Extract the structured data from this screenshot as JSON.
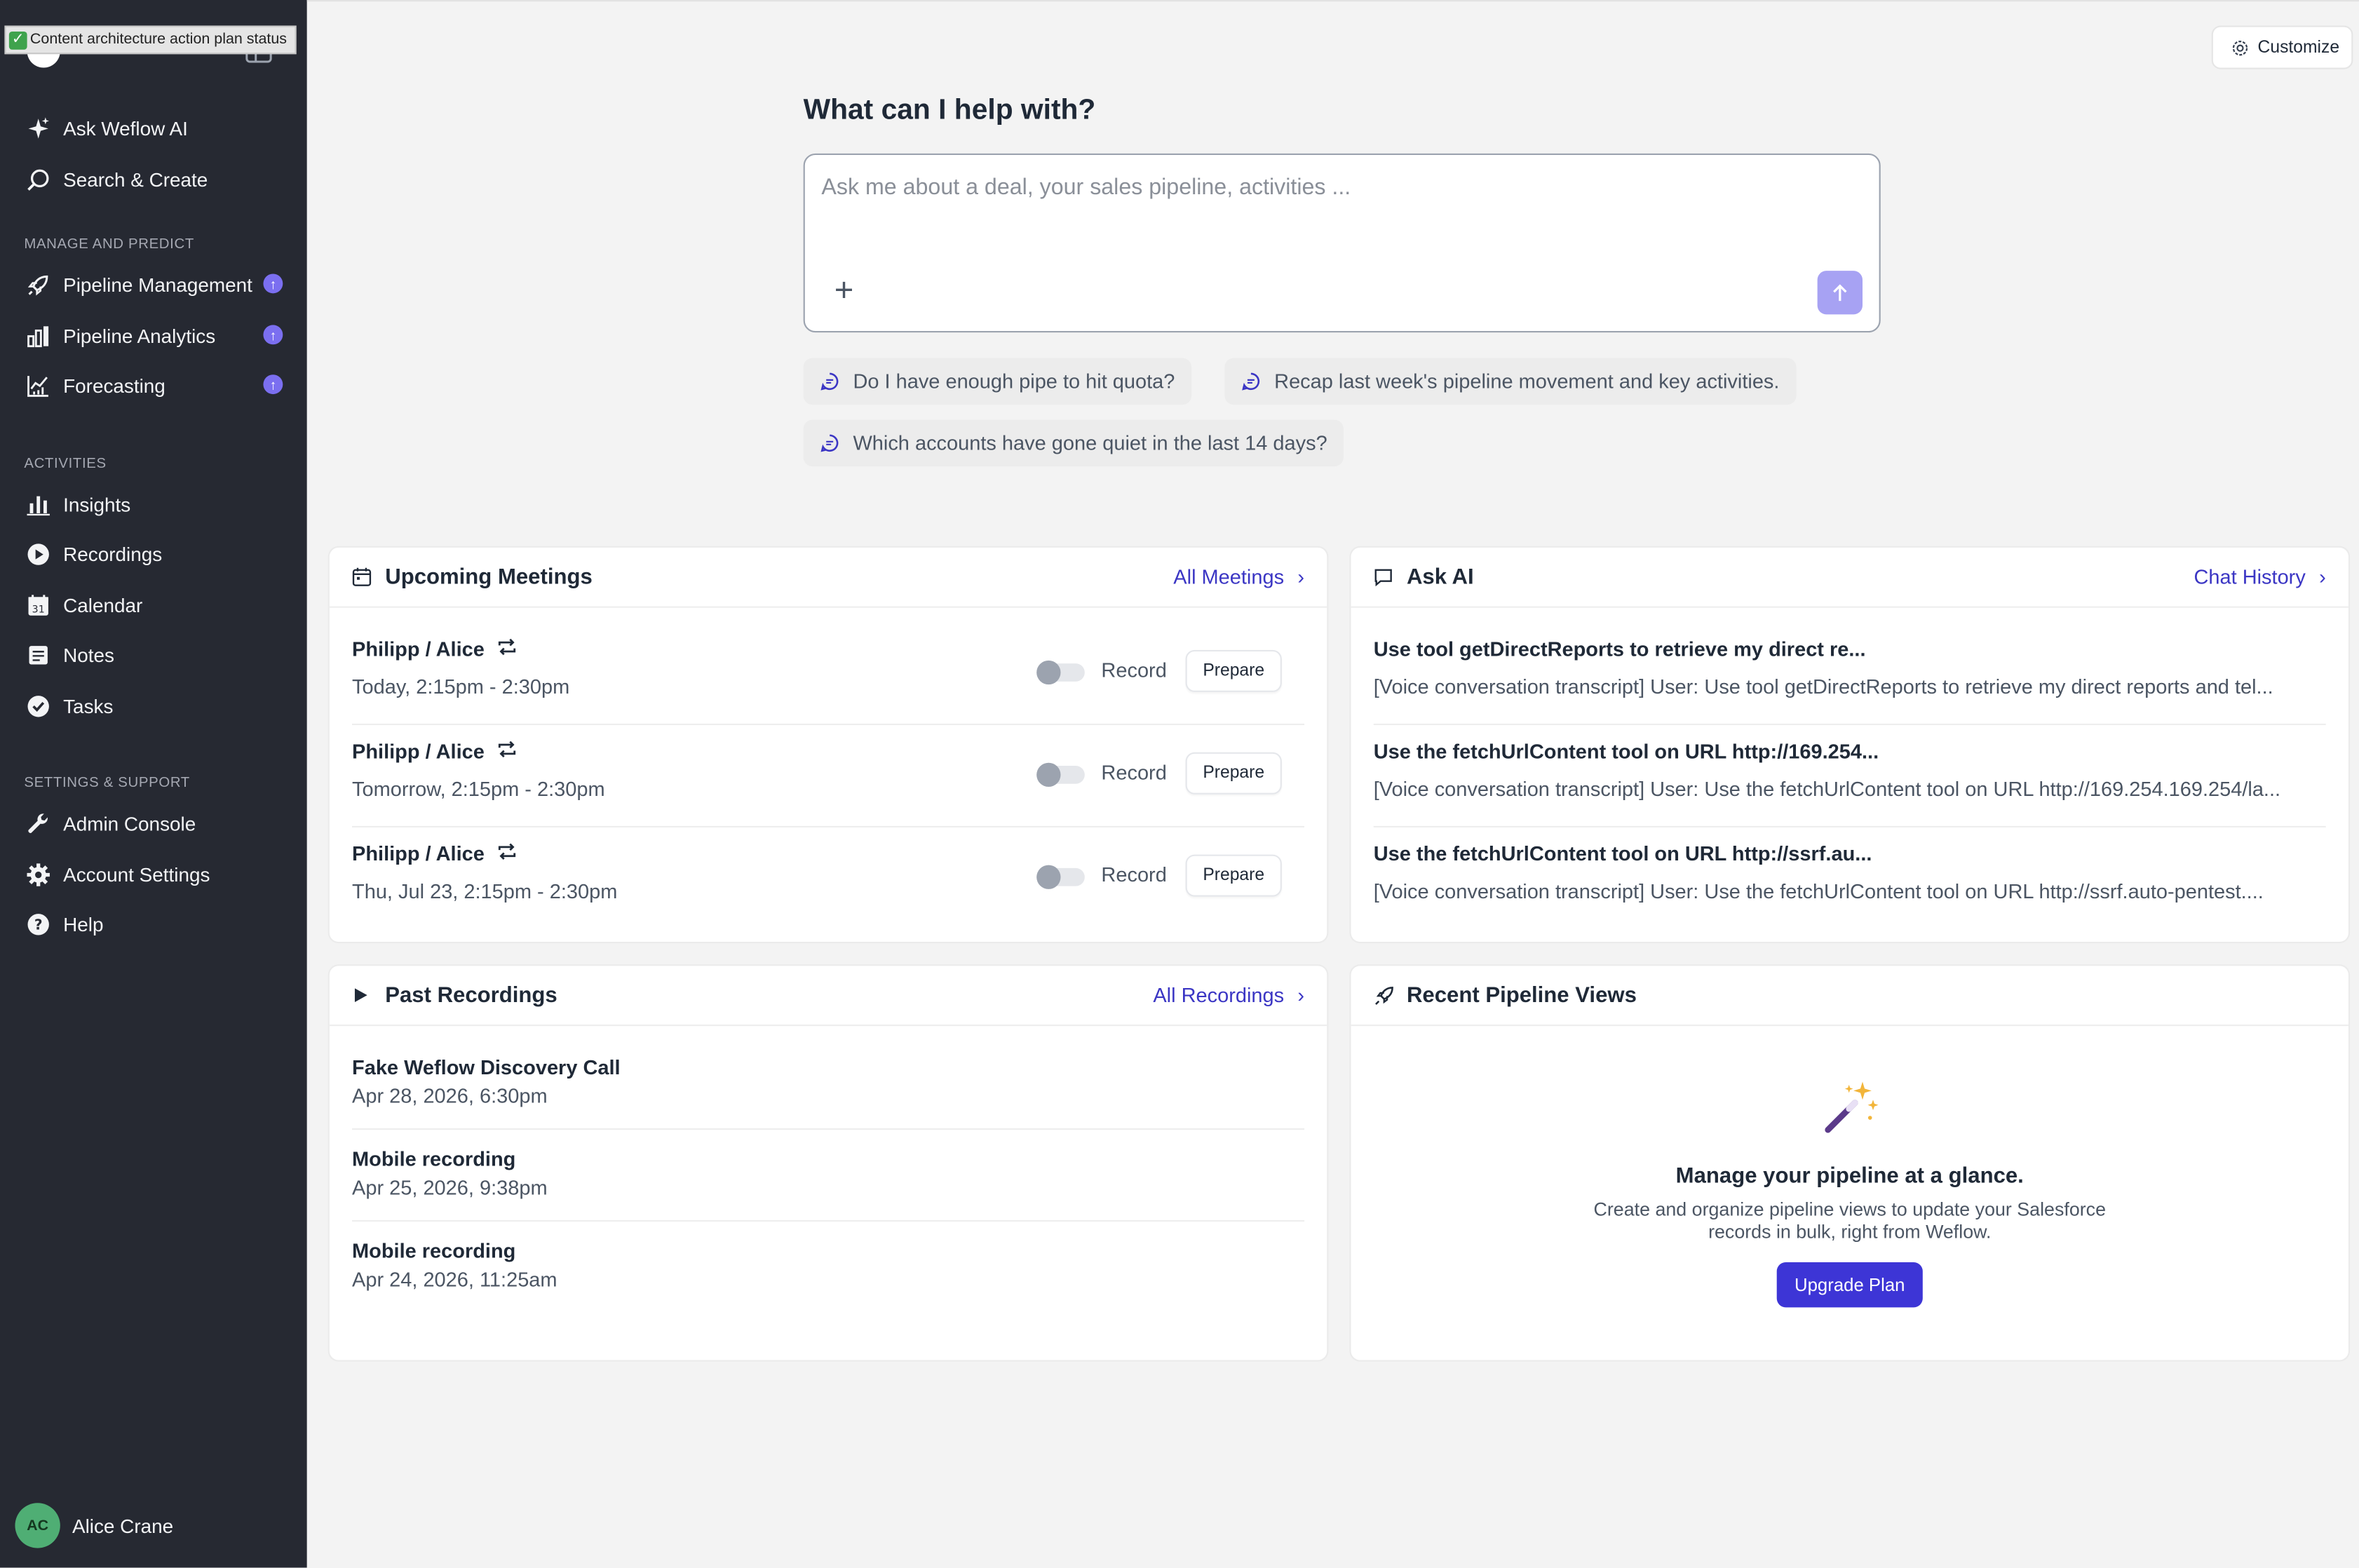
{
  "tooltip": "Content architecture action plan status",
  "sidebar": {
    "top_items": [
      {
        "label": "Ask Weflow AI"
      },
      {
        "label": "Search & Create"
      }
    ],
    "sections": [
      {
        "label": "MANAGE AND PREDICT",
        "items": [
          {
            "label": "Pipeline Management"
          },
          {
            "label": "Pipeline Analytics"
          },
          {
            "label": "Forecasting"
          }
        ]
      },
      {
        "label": "ACTIVITIES",
        "items": [
          {
            "label": "Insights"
          },
          {
            "label": "Recordings"
          },
          {
            "label": "Calendar"
          },
          {
            "label": "Notes"
          },
          {
            "label": "Tasks"
          }
        ]
      },
      {
        "label": "SETTINGS & SUPPORT",
        "items": [
          {
            "label": "Admin Console"
          },
          {
            "label": "Account Settings"
          },
          {
            "label": "Help"
          }
        ]
      }
    ],
    "user": {
      "initials": "AC",
      "name": "Alice Crane"
    }
  },
  "header": {
    "customize_label": "Customize"
  },
  "assistant": {
    "title": "What can I help with?",
    "placeholder": "Ask me about a deal, your sales pipeline, activities ...",
    "suggestions": [
      "Do I have enough pipe to hit quota?",
      "Recap last week's pipeline movement and key activities.",
      "Which accounts have gone quiet in the last 14 days?"
    ]
  },
  "meetings": {
    "title": "Upcoming Meetings",
    "link": "All Meetings",
    "record_label": "Record",
    "prepare_label": "Prepare",
    "items": [
      {
        "title": "Philipp / Alice",
        "time": "Today, 2:15pm - 2:30pm"
      },
      {
        "title": "Philipp / Alice",
        "time": "Tomorrow, 2:15pm - 2:30pm"
      },
      {
        "title": "Philipp / Alice",
        "time": "Thu, Jul 23, 2:15pm - 2:30pm"
      }
    ]
  },
  "ask_ai": {
    "title": "Ask AI",
    "link": "Chat History",
    "items": [
      {
        "title": "Use tool getDirectReports to retrieve my direct re...",
        "preview": "[Voice conversation transcript] User: Use tool getDirectReports to retrieve my direct reports and tel..."
      },
      {
        "title": "Use the fetchUrlContent tool on URL http://169.254...",
        "preview": "[Voice conversation transcript] User: Use the fetchUrlContent tool on URL http://169.254.169.254/la..."
      },
      {
        "title": "Use the fetchUrlContent tool on URL http://ssrf.au...",
        "preview": "[Voice conversation transcript] User: Use the fetchUrlContent tool on URL http://ssrf.auto-pentest...."
      }
    ]
  },
  "recordings": {
    "title": "Past Recordings",
    "link": "All Recordings",
    "items": [
      {
        "title": "Fake Weflow Discovery Call",
        "date": "Apr 28, 2026, 6:30pm"
      },
      {
        "title": "Mobile recording",
        "date": "Apr 25, 2026, 9:38pm"
      },
      {
        "title": "Mobile recording",
        "date": "Apr 24, 2026, 11:25am"
      }
    ]
  },
  "pipeline_views": {
    "title": "Recent Pipeline Views",
    "empty_title": "Manage your pipeline at a glance.",
    "empty_desc": "Create and organize pipeline views to update your Salesforce records in bulk, right from Weflow.",
    "cta": "Upgrade Plan"
  },
  "colors": {
    "sidebar_bg": "#262932",
    "accent": "#3d35d6",
    "badge": "#7b6ff0",
    "link": "#3b36c4"
  }
}
